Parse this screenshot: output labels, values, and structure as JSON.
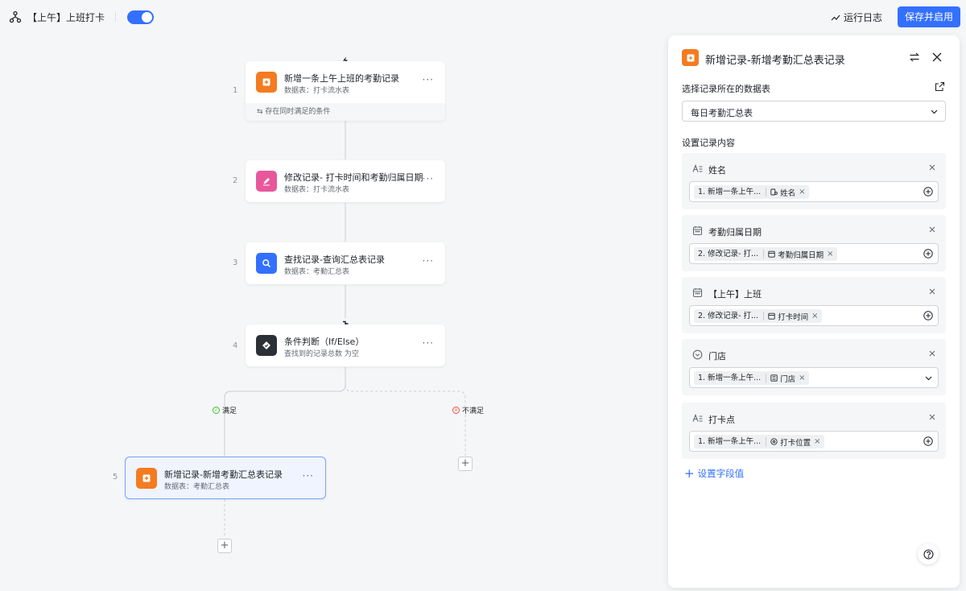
{
  "header": {
    "workflow_title": "【上午】上班打卡",
    "enabled": true,
    "run_log_label": "运行日志",
    "save_button_label": "保存并启用"
  },
  "nodes": [
    {
      "step": "1",
      "title": "新增一条上午上班的考勤记录",
      "subtitle": "数据表：打卡流水表",
      "condition": "存在同时满足的条件",
      "icon": "add-record-icon",
      "color": "#f47b20"
    },
    {
      "step": "2",
      "title": "修改记录- 打卡时间和考勤归属日期",
      "subtitle": "数据表：打卡流水表",
      "icon": "edit-icon",
      "color": "#e8579c"
    },
    {
      "step": "3",
      "title": "查找记录-查询汇总表记录",
      "subtitle": "数据表：考勤汇总表",
      "icon": "search-icon",
      "color": "#3370ff"
    },
    {
      "step": "4",
      "title": "条件判断（If/Else）",
      "subtitle": "查找到的记录总数 为空",
      "icon": "condition-icon",
      "color": "#2b2f36"
    },
    {
      "step": "5",
      "title": "新增记录-新增考勤汇总表记录",
      "subtitle": "数据表：考勤汇总表",
      "icon": "add-record-icon",
      "color": "#f47b20"
    }
  ],
  "branches": {
    "yes_label": "满足",
    "no_label": "不满足"
  },
  "panel": {
    "title": "新增记录-新增考勤汇总表记录",
    "table_label": "选择记录所在的数据表",
    "table_value": "每日考勤汇总表",
    "content_label": "设置记录内容",
    "fields": [
      {
        "name": "姓名",
        "icon": "text-field-icon",
        "tag_step": "1. 新增一条上午...",
        "tag_field": "姓名",
        "tag_icon": "person-field-icon",
        "control": "plus"
      },
      {
        "name": "考勤归属日期",
        "icon": "date-field-icon",
        "tag_step": "2. 修改记录- 打...",
        "tag_field": "考勤归属日期",
        "tag_icon": "date-field-icon",
        "control": "plus"
      },
      {
        "name": "【上午】上班",
        "icon": "date-field-icon",
        "tag_step": "2. 修改记录- 打...",
        "tag_field": "打卡时间",
        "tag_icon": "date-field-icon",
        "control": "plus"
      },
      {
        "name": "门店",
        "icon": "single-select-icon",
        "tag_step": "1. 新增一条上午...",
        "tag_field": "门店",
        "tag_icon": "lookup-field-icon",
        "control": "dropdown"
      },
      {
        "name": "打卡点",
        "icon": "text-field-icon",
        "tag_step": "1. 新增一条上午...",
        "tag_field": "打卡位置",
        "tag_icon": "location-field-icon",
        "control": "plus"
      }
    ],
    "add_field_label": "设置字段值"
  }
}
